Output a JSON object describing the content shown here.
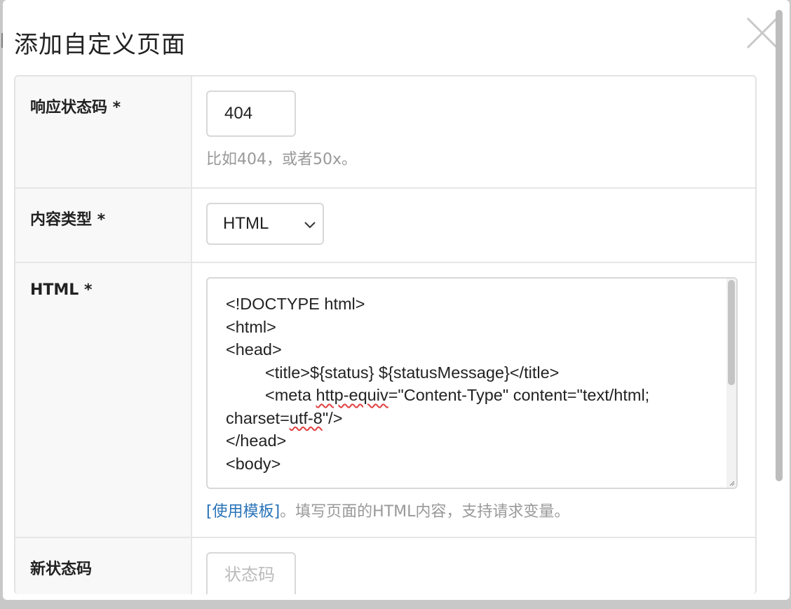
{
  "background": {
    "partial_text": "网"
  },
  "dialog": {
    "title": "添加自定义页面",
    "close_label": "×"
  },
  "form": {
    "status_code": {
      "label": "响应状态码 *",
      "value": "404",
      "hint": "比如404，或者50x。"
    },
    "content_type": {
      "label": "内容类型 *",
      "selected": "HTML"
    },
    "html": {
      "label": "HTML *",
      "lines": [
        "<!DOCTYPE html>",
        "<html>",
        "<head>",
        "<title>${status} ${statusMessage}</title>",
        "<meta ",
        "http-equiv",
        "=\"Content-Type\" content=\"text/html;",
        "charset=",
        "utf-8",
        "\"/>",
        "</head>",
        "<body>"
      ],
      "template_link": "[使用模板]",
      "hint": "。填写页面的HTML内容，支持请求变量。"
    },
    "new_status_code": {
      "label": "新状态码",
      "placeholder": "状态码"
    }
  }
}
